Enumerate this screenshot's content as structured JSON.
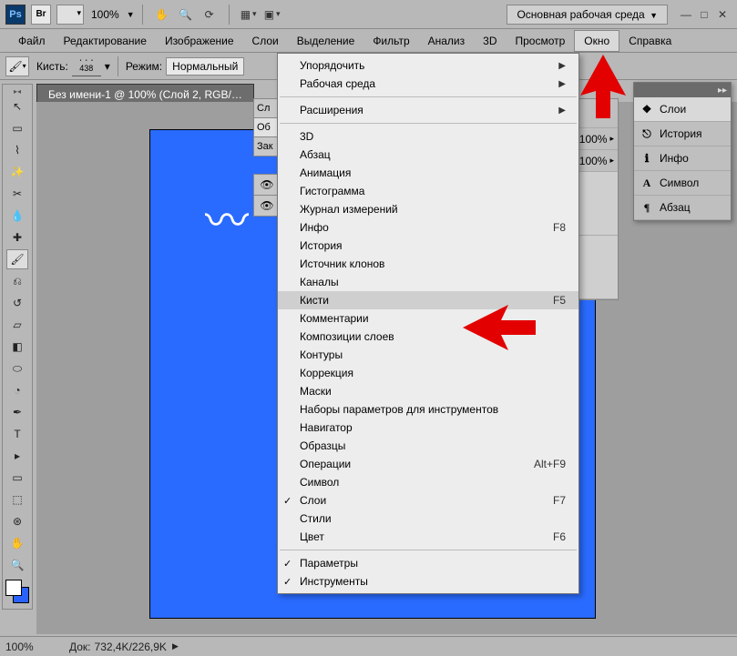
{
  "topbar": {
    "ps": "Ps",
    "br": "Br",
    "zoom": "100%",
    "workspace": "Основная рабочая среда"
  },
  "menubar": {
    "items": [
      "Файл",
      "Редактирование",
      "Изображение",
      "Слои",
      "Выделение",
      "Фильтр",
      "Анализ",
      "3D",
      "Просмотр",
      "Окно",
      "Справка"
    ],
    "active_index": 9
  },
  "options": {
    "brush_label": "Кисть:",
    "brush_size": "438",
    "mode_label": "Режим:",
    "mode_value": "Нормальный"
  },
  "doc_tab": "Без имени-1 @ 100% (Слой 2, RGB/…",
  "layers_stub": {
    "t0": "Сл",
    "t1": "Об",
    "t2": "Зак"
  },
  "side_values": {
    "a": "100%",
    "b": "100%"
  },
  "dropdown": {
    "groups": [
      [
        {
          "label": "Упорядочить",
          "sub": true
        },
        {
          "label": "Рабочая среда",
          "sub": true
        }
      ],
      [
        {
          "label": "Расширения",
          "sub": true
        }
      ],
      [
        {
          "label": "3D"
        },
        {
          "label": "Абзац"
        },
        {
          "label": "Анимация"
        },
        {
          "label": "Гистограмма"
        },
        {
          "label": "Журнал измерений"
        },
        {
          "label": "Инфо",
          "shortcut": "F8"
        },
        {
          "label": "История"
        },
        {
          "label": "Источник клонов"
        },
        {
          "label": "Каналы"
        },
        {
          "label": "Кисти",
          "shortcut": "F5",
          "hover": true
        },
        {
          "label": "Комментарии"
        },
        {
          "label": "Композиции слоев"
        },
        {
          "label": "Контуры"
        },
        {
          "label": "Коррекция"
        },
        {
          "label": "Маски"
        },
        {
          "label": "Наборы параметров для инструментов"
        },
        {
          "label": "Навигатор"
        },
        {
          "label": "Образцы"
        },
        {
          "label": "Операции",
          "shortcut": "Alt+F9"
        },
        {
          "label": "Символ"
        },
        {
          "label": "Слои",
          "shortcut": "F7",
          "checked": true
        },
        {
          "label": "Стили"
        },
        {
          "label": "Цвет",
          "shortcut": "F6"
        }
      ],
      [
        {
          "label": "Параметры",
          "checked": true
        },
        {
          "label": "Инструменты",
          "checked": true
        }
      ]
    ]
  },
  "panel_group": {
    "rows": [
      {
        "icon": "❖",
        "label": "Слои",
        "selected": true
      },
      {
        "icon": "⎋",
        "label": "История"
      },
      {
        "icon": "ℹ",
        "label": "Инфо"
      },
      {
        "icon": "A",
        "label": "Символ"
      },
      {
        "icon": "¶",
        "label": "Абзац"
      }
    ]
  },
  "statusbar": {
    "zoom": "100%",
    "doc_label": "Док:",
    "doc_value": "732,4K/226,9K"
  }
}
